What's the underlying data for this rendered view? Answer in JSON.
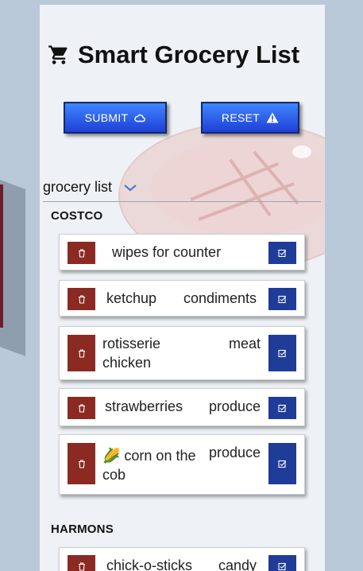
{
  "header": {
    "title": "Smart Grocery List"
  },
  "buttons": {
    "submit": "SUBMIT",
    "reset": "RESET"
  },
  "list": {
    "label": "grocery list"
  },
  "stores": [
    {
      "name": "COSTCO",
      "items": [
        {
          "name": "wipes for counter",
          "category": ""
        },
        {
          "name": "ketchup",
          "category": "condiments"
        },
        {
          "name": "rotisserie chicken",
          "category": "meat"
        },
        {
          "name": "strawberries",
          "category": "produce"
        },
        {
          "name": "🌽 corn on the cob",
          "category": "produce"
        }
      ]
    },
    {
      "name": "HARMONS",
      "items": [
        {
          "name": "chick-o-sticks",
          "category": "candy"
        }
      ]
    }
  ],
  "icons": {
    "title": "cart-icon",
    "submit": "cloud-icon",
    "reset": "warning-icon",
    "list_toggle": "chevron-down-icon",
    "delete": "trash-icon",
    "check": "edit-check-icon"
  },
  "colors": {
    "delete": "#8b2a22",
    "check": "#1f3c99",
    "button": "#2f6df5"
  }
}
